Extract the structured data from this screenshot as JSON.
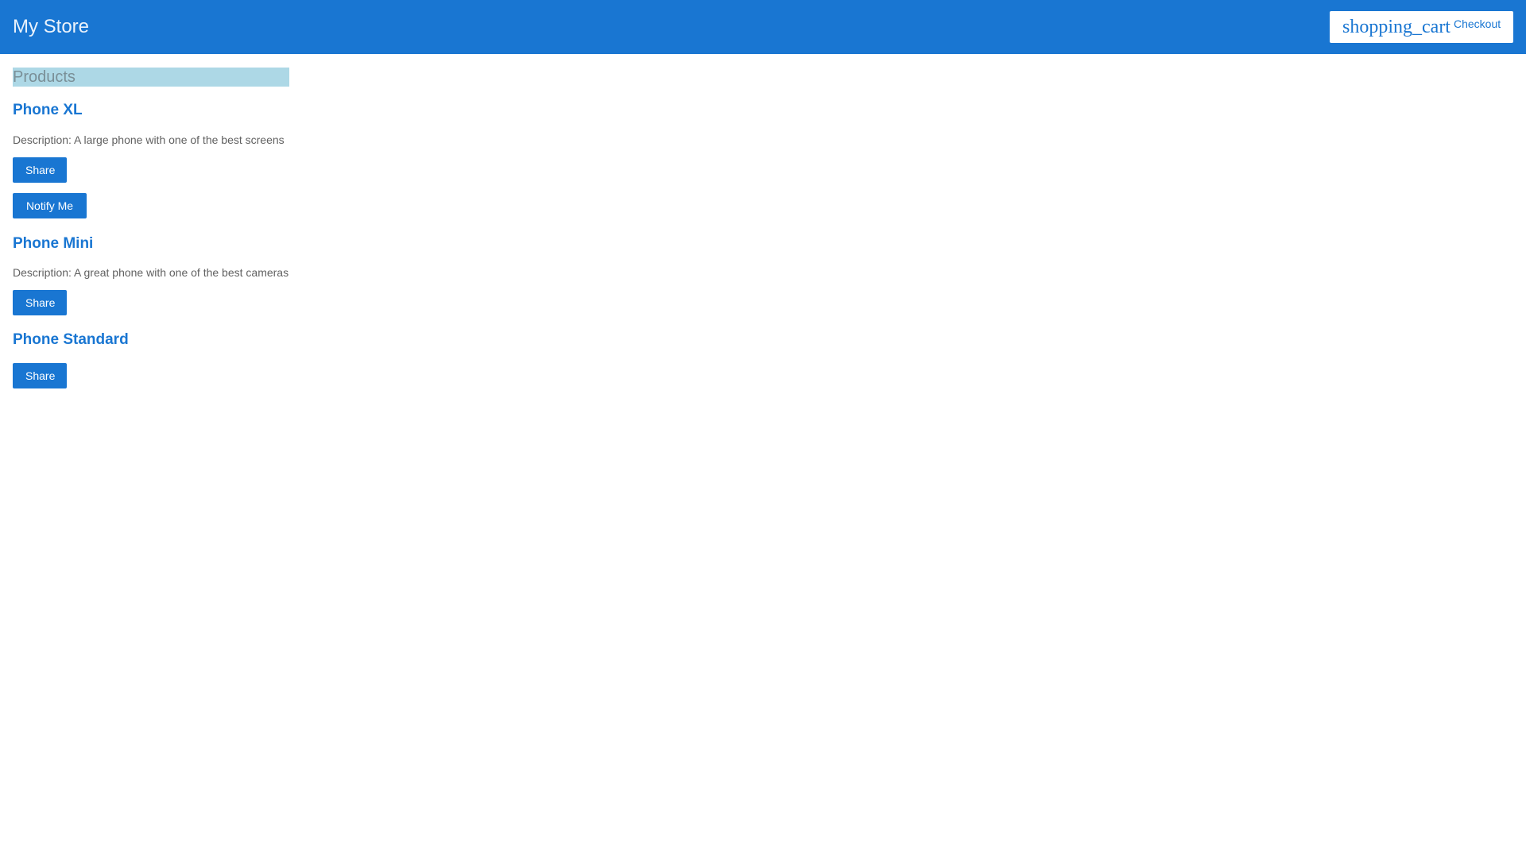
{
  "header": {
    "store_title": "My Store",
    "checkout": {
      "icon_text": "shopping_cart",
      "label": "Checkout"
    }
  },
  "products_heading": "Products",
  "products": [
    {
      "name": "Phone XL",
      "description": "Description: A large phone with one of the best screens",
      "share_label": "Share",
      "notify_label": "Notify Me"
    },
    {
      "name": "Phone Mini",
      "description": "Description: A great phone with one of the best cameras",
      "share_label": "Share"
    },
    {
      "name": "Phone Standard",
      "share_label": "Share"
    }
  ],
  "colors": {
    "primary": "#1976d2",
    "heading_highlight": "#add8e6",
    "text": "#616161"
  },
  "icons": {
    "cart": "shopping-cart-icon"
  }
}
